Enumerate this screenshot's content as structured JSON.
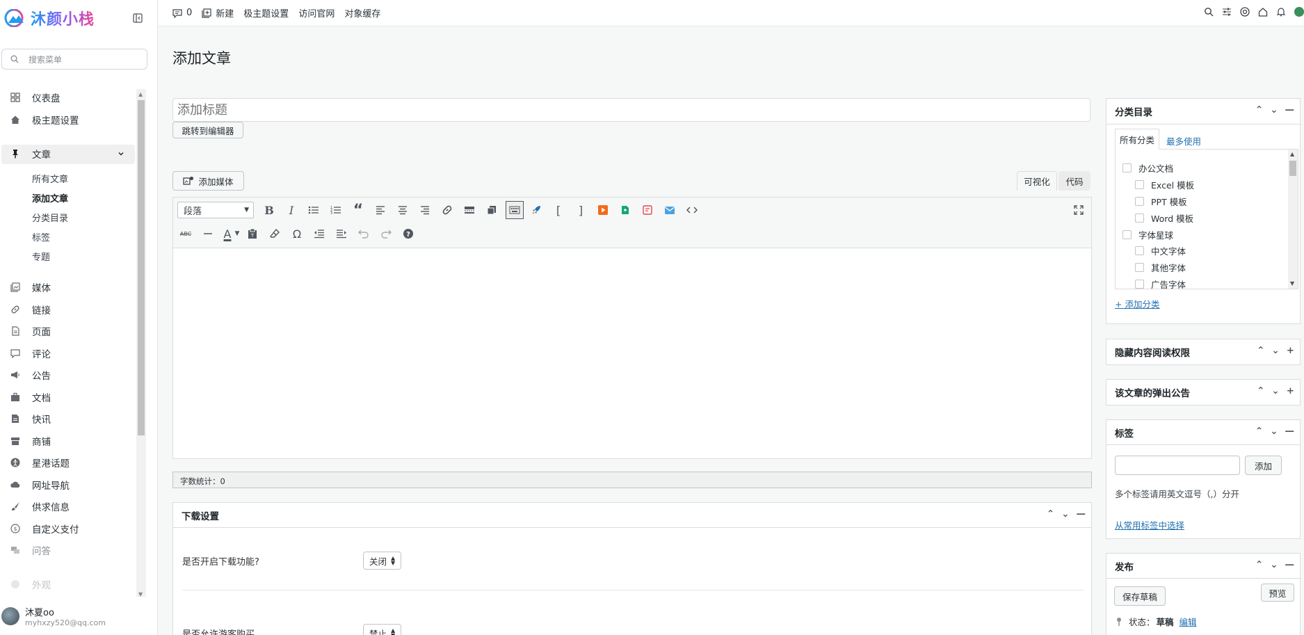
{
  "sidebar": {
    "logo_text": "沐颜小栈",
    "search_placeholder": "搜索菜单",
    "menu": [
      {
        "label": "仪表盘",
        "icon": "dashboard-icon"
      },
      {
        "label": "极主题设置",
        "icon": "home-icon"
      },
      {
        "label": "文章",
        "icon": "pin-icon"
      },
      {
        "label": "媒体",
        "icon": "media-icon"
      },
      {
        "label": "链接",
        "icon": "link-icon"
      },
      {
        "label": "页面",
        "icon": "page-icon"
      },
      {
        "label": "评论",
        "icon": "comment-icon"
      },
      {
        "label": "公告",
        "icon": "megaphone-icon"
      },
      {
        "label": "文档",
        "icon": "briefcase-icon"
      },
      {
        "label": "快讯",
        "icon": "document-icon"
      },
      {
        "label": "商铺",
        "icon": "store-icon"
      },
      {
        "label": "星港话题",
        "icon": "universal-access-icon"
      },
      {
        "label": "网址导航",
        "icon": "cloud-icon"
      },
      {
        "label": "供求信息",
        "icon": "brush-icon"
      },
      {
        "label": "自定义支付",
        "icon": "money-icon"
      },
      {
        "label": "问答",
        "icon": "chat-icon"
      },
      {
        "label": "外观",
        "icon": "appearance-icon"
      }
    ],
    "submenu": [
      "所有文章",
      "添加文章",
      "分类目录",
      "标签",
      "专题"
    ],
    "user": {
      "name": "沐夏oo",
      "email": "myhxzy520@qq.com"
    }
  },
  "topbar": {
    "comments_count": "0",
    "new_label": "新建",
    "theme_settings": "极主题设置",
    "visit_site": "访问官网",
    "object_cache": "对象缓存"
  },
  "main": {
    "page_title": "添加文章",
    "title_placeholder": "添加标题",
    "jump_editor": "跳转到编辑器",
    "add_media": "添加媒体",
    "tab_visual": "可视化",
    "tab_code": "代码",
    "paragraph_select": "段落",
    "word_count": "字数统计：0"
  },
  "download_box": {
    "title": "下载设置",
    "q1_label": "是否开启下载功能?",
    "q1_value": "关闭",
    "q2_label": "是否允许游客购买",
    "q2_value": "禁止"
  },
  "category_box": {
    "title": "分类目录",
    "tab_all": "所有分类",
    "tab_most": "最多使用",
    "items": [
      {
        "label": "办公文档",
        "level": 0
      },
      {
        "label": "Excel 模板",
        "level": 1
      },
      {
        "label": "PPT 模板",
        "level": 1
      },
      {
        "label": "Word 模板",
        "level": 1
      },
      {
        "label": "字体星球",
        "level": 0
      },
      {
        "label": "中文字体",
        "level": 1
      },
      {
        "label": "其他字体",
        "level": 1
      },
      {
        "label": "广告字体",
        "level": 1
      }
    ],
    "add_link": "+ 添加分类"
  },
  "hidden_box": {
    "title": "隐藏内容阅读权限"
  },
  "popup_box": {
    "title": "该文章的弹出公告"
  },
  "tags_box": {
    "title": "标签",
    "add_button": "添加",
    "hint": "多个标签请用英文逗号（,）分开",
    "choose_link": "从常用标签中选择"
  },
  "publish_box": {
    "title": "发布",
    "save_draft": "保存草稿",
    "preview": "预览",
    "status_label": "状态：",
    "status_value": "草稿",
    "edit_link": "编辑"
  }
}
